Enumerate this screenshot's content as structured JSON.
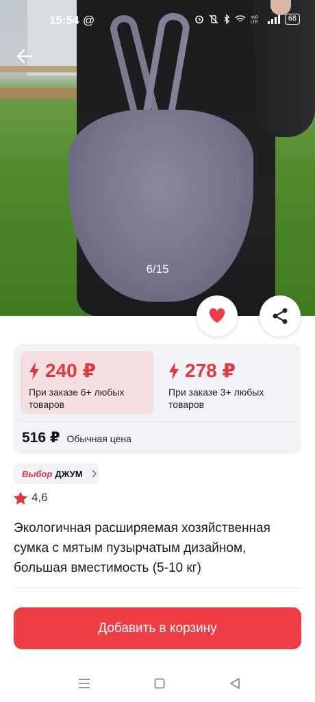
{
  "status_bar": {
    "time": "15:54",
    "at_symbol": "@",
    "battery": "68",
    "network_label": "VoD LTE"
  },
  "gallery": {
    "counter": "6/15"
  },
  "prices": {
    "tier1": {
      "price": "240 ₽",
      "description": "При заказе 6+ любых товаров"
    },
    "tier2": {
      "price": "278 ₽",
      "description": "При заказе 3+ любых товаров"
    },
    "regular": {
      "price": "516 ₽",
      "label": "Обычная цена"
    }
  },
  "badge": {
    "part1": "Выбор",
    "part2": "ДЖУМ"
  },
  "rating": {
    "value": "4,6"
  },
  "product": {
    "title": "Экологичная расширяемая хозяйственная сумка с мятым пузырчатым дизайном, большая вместимость (5-10 кг)"
  },
  "actions": {
    "add_to_cart": "Добавить в корзину"
  },
  "colors": {
    "accent": "#ef3d46",
    "price_red": "#e0383e",
    "tier_highlight": "#f6dfe1",
    "card_bg": "#f1f2f5"
  },
  "icons": [
    "back-arrow-icon",
    "heart-icon",
    "share-icon",
    "lightning-icon",
    "star-icon",
    "chevron-right-icon",
    "menu-icon",
    "home-square-icon",
    "back-triangle-icon"
  ]
}
